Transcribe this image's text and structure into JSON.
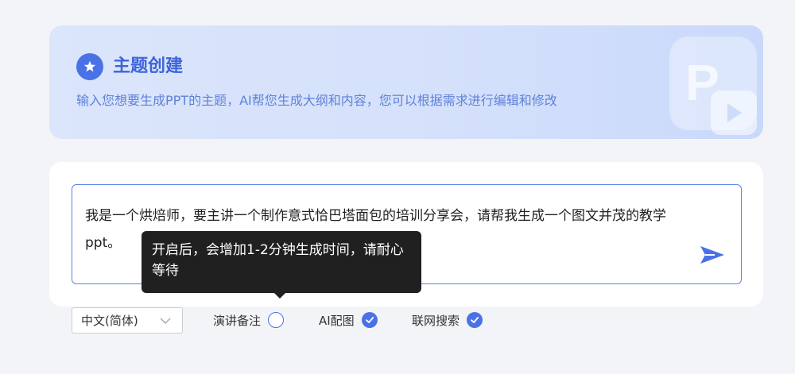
{
  "hero": {
    "title": "主题创建",
    "subtitle": "输入您想要生成PPT的主题，AI帮您生成大纲和内容，您可以根据需求进行编辑和修改",
    "deco_letter": "P"
  },
  "input": {
    "value": "我是一个烘焙师，要主讲一个制作意式恰巴塔面包的培训分享会，请帮我生成一个图文并茂的教学ppt。"
  },
  "tooltip": {
    "text": "开启后，会增加1-2分钟生成时间，请耐心等待"
  },
  "options": {
    "language": "中文(简体)",
    "speaker_notes": {
      "label": "演讲备注",
      "checked": false
    },
    "ai_image": {
      "label": "AI配图",
      "checked": true
    },
    "web_search": {
      "label": "联网搜索",
      "checked": true
    }
  },
  "colors": {
    "accent": "#4a72e6",
    "hero_title": "#3d64d9",
    "tooltip_bg": "#202020"
  },
  "icons": {
    "hero": "star-badge-icon",
    "send": "send-icon",
    "dropdown": "chevron-down-icon",
    "check": "check-circle-icon"
  }
}
